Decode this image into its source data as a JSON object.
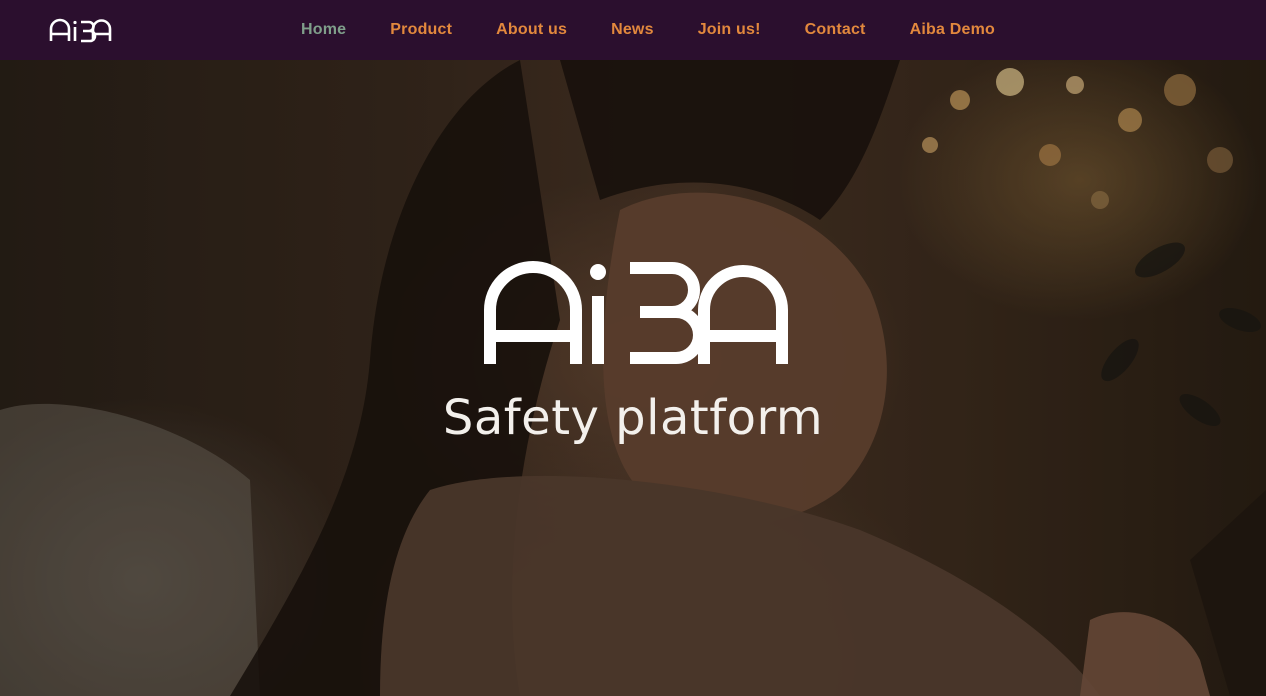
{
  "brand": {
    "name": "AiBA",
    "colors": {
      "header_bg": "#2b0f2e",
      "nav_text": "#e2883d",
      "nav_active": "#7f9e8a",
      "logo": "#ffffff"
    }
  },
  "nav": {
    "items": [
      {
        "label": "Home",
        "active": true
      },
      {
        "label": "Product",
        "active": false
      },
      {
        "label": "About us",
        "active": false
      },
      {
        "label": "News",
        "active": false
      },
      {
        "label": "Join us!",
        "active": false
      },
      {
        "label": "Contact",
        "active": false
      },
      {
        "label": "Aiba Demo",
        "active": false
      }
    ]
  },
  "hero": {
    "tagline": "Safety platform",
    "background_image": "girl-using-tablet-photo"
  }
}
